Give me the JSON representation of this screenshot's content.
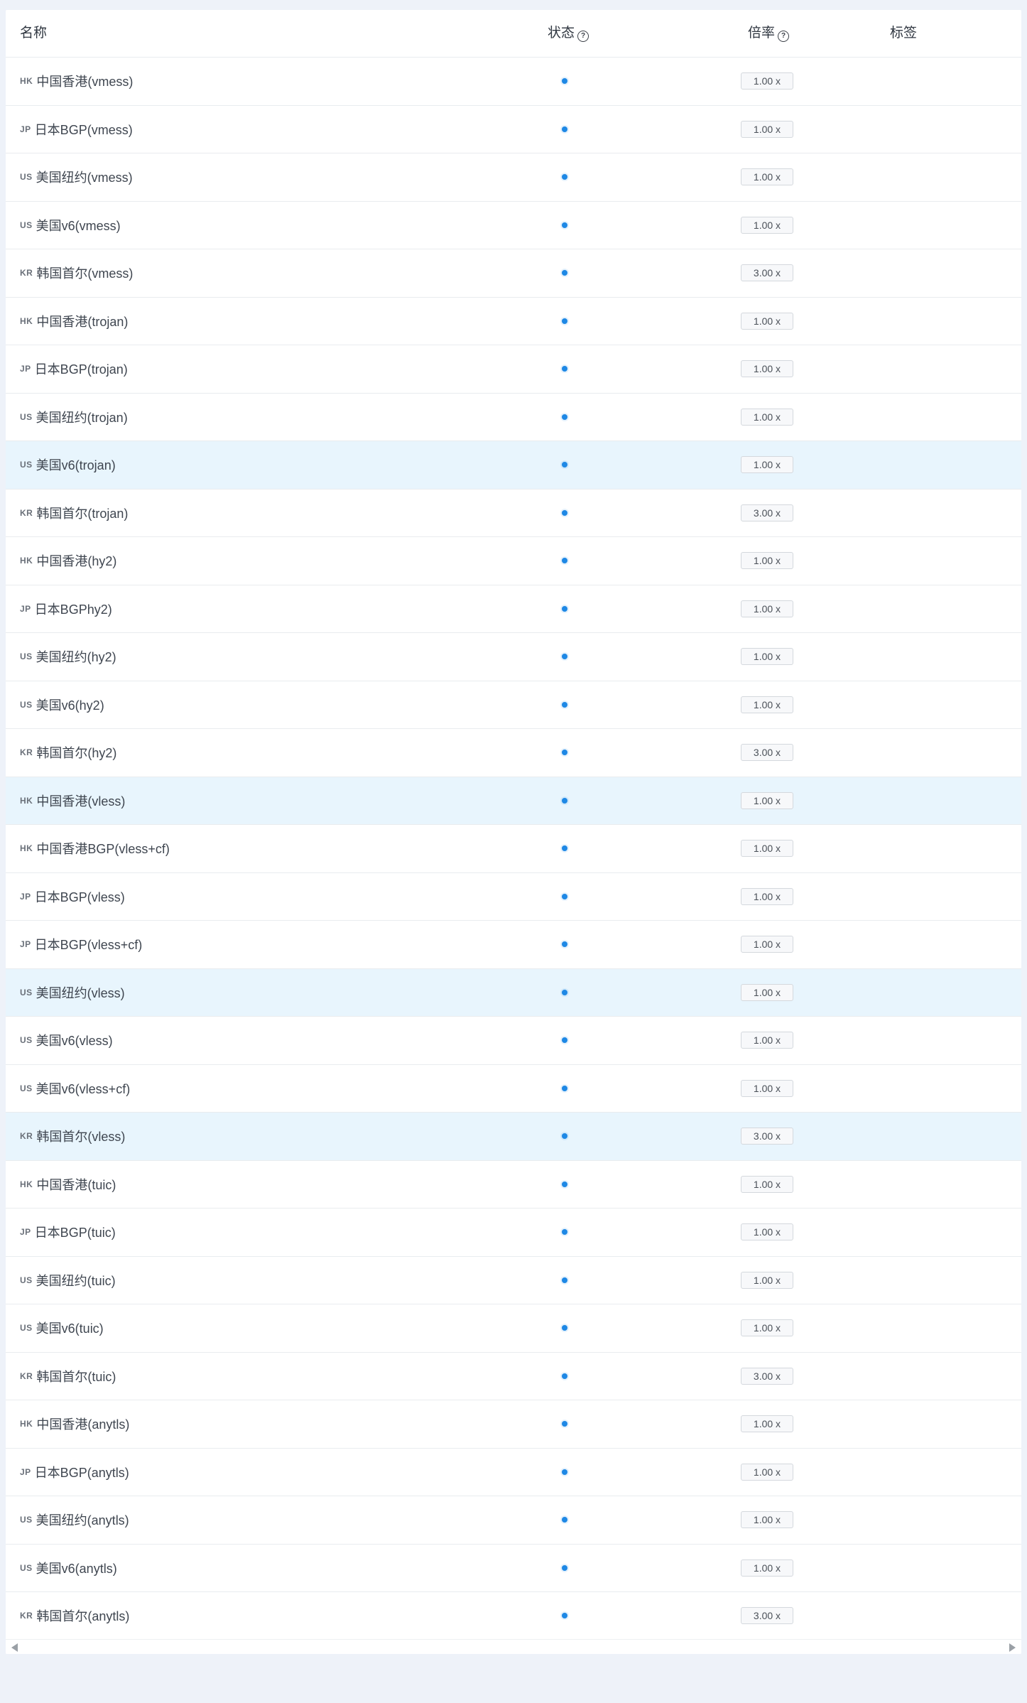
{
  "table": {
    "headers": {
      "name": "名称",
      "status": "状态",
      "rate": "倍率",
      "tags": "标签"
    },
    "status_color": "#1e88e5",
    "highlight_color": "#e8f5fd",
    "rows": [
      {
        "flag": "HK",
        "name": "中国香港(vmess)",
        "rate": "1.00 x",
        "online": true,
        "highlighted": false
      },
      {
        "flag": "JP",
        "name": "日本BGP(vmess)",
        "rate": "1.00 x",
        "online": true,
        "highlighted": false
      },
      {
        "flag": "US",
        "name": "美国纽约(vmess)",
        "rate": "1.00 x",
        "online": true,
        "highlighted": false
      },
      {
        "flag": "US",
        "name": "美国v6(vmess)",
        "rate": "1.00 x",
        "online": true,
        "highlighted": false
      },
      {
        "flag": "KR",
        "name": "韩国首尔(vmess)",
        "rate": "3.00 x",
        "online": true,
        "highlighted": false
      },
      {
        "flag": "HK",
        "name": "中国香港(trojan)",
        "rate": "1.00 x",
        "online": true,
        "highlighted": false
      },
      {
        "flag": "JP",
        "name": "日本BGP(trojan)",
        "rate": "1.00 x",
        "online": true,
        "highlighted": false
      },
      {
        "flag": "US",
        "name": "美国纽约(trojan)",
        "rate": "1.00 x",
        "online": true,
        "highlighted": false
      },
      {
        "flag": "US",
        "name": "美国v6(trojan)",
        "rate": "1.00 x",
        "online": true,
        "highlighted": true
      },
      {
        "flag": "KR",
        "name": "韩国首尔(trojan)",
        "rate": "3.00 x",
        "online": true,
        "highlighted": false
      },
      {
        "flag": "HK",
        "name": "中国香港(hy2)",
        "rate": "1.00 x",
        "online": true,
        "highlighted": false
      },
      {
        "flag": "JP",
        "name": "日本BGPhy2)",
        "rate": "1.00 x",
        "online": true,
        "highlighted": false
      },
      {
        "flag": "US",
        "name": "美国纽约(hy2)",
        "rate": "1.00 x",
        "online": true,
        "highlighted": false
      },
      {
        "flag": "US",
        "name": "美国v6(hy2)",
        "rate": "1.00 x",
        "online": true,
        "highlighted": false
      },
      {
        "flag": "KR",
        "name": "韩国首尔(hy2)",
        "rate": "3.00 x",
        "online": true,
        "highlighted": false
      },
      {
        "flag": "HK",
        "name": "中国香港(vless)",
        "rate": "1.00 x",
        "online": true,
        "highlighted": true
      },
      {
        "flag": "HK",
        "name": "中国香港BGP(vless+cf)",
        "rate": "1.00 x",
        "online": true,
        "highlighted": false
      },
      {
        "flag": "JP",
        "name": "日本BGP(vless)",
        "rate": "1.00 x",
        "online": true,
        "highlighted": false
      },
      {
        "flag": "JP",
        "name": "日本BGP(vless+cf)",
        "rate": "1.00 x",
        "online": true,
        "highlighted": false
      },
      {
        "flag": "US",
        "name": "美国纽约(vless)",
        "rate": "1.00 x",
        "online": true,
        "highlighted": true
      },
      {
        "flag": "US",
        "name": "美国v6(vless)",
        "rate": "1.00 x",
        "online": true,
        "highlighted": false
      },
      {
        "flag": "US",
        "name": "美国v6(vless+cf)",
        "rate": "1.00 x",
        "online": true,
        "highlighted": false
      },
      {
        "flag": "KR",
        "name": "韩国首尔(vless)",
        "rate": "3.00 x",
        "online": true,
        "highlighted": true
      },
      {
        "flag": "HK",
        "name": "中国香港(tuic)",
        "rate": "1.00 x",
        "online": true,
        "highlighted": false
      },
      {
        "flag": "JP",
        "name": "日本BGP(tuic)",
        "rate": "1.00 x",
        "online": true,
        "highlighted": false
      },
      {
        "flag": "US",
        "name": "美国纽约(tuic)",
        "rate": "1.00 x",
        "online": true,
        "highlighted": false
      },
      {
        "flag": "US",
        "name": "美国v6(tuic)",
        "rate": "1.00 x",
        "online": true,
        "highlighted": false
      },
      {
        "flag": "KR",
        "name": "韩国首尔(tuic)",
        "rate": "3.00 x",
        "online": true,
        "highlighted": false
      },
      {
        "flag": "HK",
        "name": "中国香港(anytls)",
        "rate": "1.00 x",
        "online": true,
        "highlighted": false
      },
      {
        "flag": "JP",
        "name": "日本BGP(anytls)",
        "rate": "1.00 x",
        "online": true,
        "highlighted": false
      },
      {
        "flag": "US",
        "name": "美国纽约(anytls)",
        "rate": "1.00 x",
        "online": true,
        "highlighted": false
      },
      {
        "flag": "US",
        "name": "美国v6(anytls)",
        "rate": "1.00 x",
        "online": true,
        "highlighted": false
      },
      {
        "flag": "KR",
        "name": "韩国首尔(anytls)",
        "rate": "3.00 x",
        "online": true,
        "highlighted": false
      }
    ]
  },
  "scrollbar": {
    "left_icon": "caret-left-icon",
    "right_icon": "caret-right-icon"
  }
}
